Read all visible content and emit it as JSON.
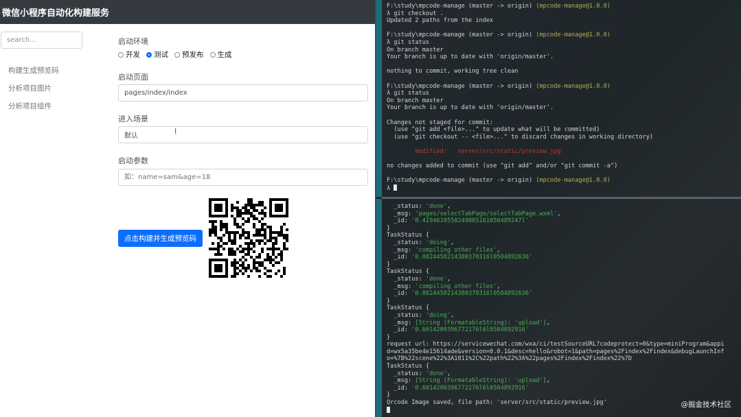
{
  "app": {
    "title": "微信小程序自动化构建服务",
    "search_placeholder": "search...",
    "sidebar": [
      {
        "label": "构建生成预览码"
      },
      {
        "label": "分析项目图片"
      },
      {
        "label": "分析项目组件"
      }
    ],
    "form": {
      "env_label": "启动环境",
      "env_options": [
        {
          "label": "开发",
          "checked": false
        },
        {
          "label": "测试",
          "checked": true
        },
        {
          "label": "预发布",
          "checked": false
        },
        {
          "label": "生成",
          "checked": false
        }
      ],
      "page_label": "启动页面",
      "page_value": "pages/index/index",
      "scene_label": "进入场景",
      "scene_value": "默认",
      "params_label": "启动参数",
      "params_placeholder": "如：name=sam&age=18",
      "build_button": "点击构建并生成预览码"
    },
    "accent_color": "#0d6efd"
  },
  "terminal_top": [
    [
      {
        "t": "F:\\study\\mpcode-manage ",
        "c": "t-path"
      },
      {
        "t": "(master -> origin) ",
        "c": "t-branch"
      },
      {
        "t": "(mpcode-manage@1.0.0)",
        "c": "t-pkg"
      }
    ],
    [
      {
        "t": "λ git checkout .",
        "c": "t-lambda"
      }
    ],
    [
      {
        "t": "Updated 2 paths from the index"
      }
    ],
    [
      {
        "t": ""
      }
    ],
    [
      {
        "t": "F:\\study\\mpcode-manage ",
        "c": "t-path"
      },
      {
        "t": "(master -> origin) ",
        "c": "t-branch"
      },
      {
        "t": "(mpcode-manage@1.0.0)",
        "c": "t-pkg"
      }
    ],
    [
      {
        "t": "λ git status",
        "c": "t-lambda"
      }
    ],
    [
      {
        "t": "On branch master"
      }
    ],
    [
      {
        "t": "Your branch is up to date with 'origin/master'."
      }
    ],
    [
      {
        "t": ""
      }
    ],
    [
      {
        "t": "nothing to commit, working tree clean"
      }
    ],
    [
      {
        "t": ""
      }
    ],
    [
      {
        "t": "F:\\study\\mpcode-manage ",
        "c": "t-path"
      },
      {
        "t": "(master -> origin) ",
        "c": "t-branch"
      },
      {
        "t": "(mpcode-manage@1.0.0)",
        "c": "t-pkg"
      }
    ],
    [
      {
        "t": "λ git status",
        "c": "t-lambda"
      }
    ],
    [
      {
        "t": "On branch master"
      }
    ],
    [
      {
        "t": "Your branch is up to date with 'origin/master'."
      }
    ],
    [
      {
        "t": ""
      }
    ],
    [
      {
        "t": "Changes not staged for commit:"
      }
    ],
    [
      {
        "t": "  (use \"git add <file>...\" to update what will be committed)"
      }
    ],
    [
      {
        "t": "  (use \"git checkout -- <file>...\" to discard changes in working directory)"
      }
    ],
    [
      {
        "t": ""
      }
    ],
    [
      {
        "t": "        modified:   server/src/static/preview.jpg",
        "c": "t-red"
      }
    ],
    [
      {
        "t": ""
      }
    ],
    [
      {
        "t": "no changes added to commit (use \"git add\" and/or \"git commit -a\")"
      }
    ],
    [
      {
        "t": ""
      }
    ],
    [
      {
        "t": "F:\\study\\mpcode-manage ",
        "c": "t-path"
      },
      {
        "t": "(master -> origin) ",
        "c": "t-branch"
      },
      {
        "t": "(mpcode-manage@1.0.0)",
        "c": "t-pkg"
      }
    ],
    [
      {
        "t": "λ ",
        "c": "t-lambda"
      },
      {
        "cursor": true
      }
    ]
  ],
  "terminal_bottom": [
    [
      {
        "t": "  _status: "
      },
      {
        "t": "'done'",
        "c": "t-str"
      },
      {
        "t": ","
      }
    ],
    [
      {
        "t": "  _msg: "
      },
      {
        "t": "'pages/selectTabPage/selectTabPage.wxml'",
        "c": "t-str"
      },
      {
        "t": ","
      }
    ],
    [
      {
        "t": "  _id: "
      },
      {
        "t": "'0.4194610558249885161050489247l'",
        "c": "t-str"
      }
    ],
    [
      {
        "t": "}"
      }
    ],
    [
      {
        "t": "TaskStatus {"
      }
    ],
    [
      {
        "t": "  _status: "
      },
      {
        "t": "'doing'",
        "c": "t-str"
      },
      {
        "t": ","
      }
    ],
    [
      {
        "t": "  _msg: "
      },
      {
        "t": "'compiling other files'",
        "c": "t-str"
      },
      {
        "t": ","
      }
    ],
    [
      {
        "t": "  _id: "
      },
      {
        "t": "'0.0824458214380370316l0504892636'",
        "c": "t-str"
      }
    ],
    [
      {
        "t": "}"
      }
    ],
    [
      {
        "t": "TaskStatus {"
      }
    ],
    [
      {
        "t": "  _status: "
      },
      {
        "t": "'done'",
        "c": "t-str"
      },
      {
        "t": ","
      }
    ],
    [
      {
        "t": "  _msg: "
      },
      {
        "t": "'compiling other files'",
        "c": "t-str"
      },
      {
        "t": ","
      }
    ],
    [
      {
        "t": "  _id: "
      },
      {
        "t": "'0.0824458214380370316l0504892636'",
        "c": "t-str"
      }
    ],
    [
      {
        "t": "}"
      }
    ],
    [
      {
        "t": "TaskStatus {"
      }
    ],
    [
      {
        "t": "  _status: "
      },
      {
        "t": "'doing'",
        "c": "t-str"
      },
      {
        "t": ","
      }
    ],
    [
      {
        "t": "  _msg: "
      },
      {
        "t": "[String (FormatableString): 'upload']",
        "c": "t-str"
      },
      {
        "t": ","
      }
    ],
    [
      {
        "t": "  _id: "
      },
      {
        "t": "'0.6014200396772176l6l0504892916'",
        "c": "t-str"
      }
    ],
    [
      {
        "t": "}"
      }
    ],
    [
      {
        "t": "request url: https://servicewechat.com/wxa/ci/testSourceURL?codeprotect=0&type=miniProgram&appi"
      }
    ],
    [
      {
        "t": "d=wx5a35be4e15614ade&version=0.0.1&desc=hello&robot=1&path=pages%2Findex%2Findex&debugLaunchInf"
      }
    ],
    [
      {
        "t": "o=%7B%22scene%22%3A1011%2C%22path%22%3A%22pages%2Findex%2Findex%22%7D"
      }
    ],
    [
      {
        "t": "TaskStatus {"
      }
    ],
    [
      {
        "t": "  _status: "
      },
      {
        "t": "'done'",
        "c": "t-str"
      },
      {
        "t": ","
      }
    ],
    [
      {
        "t": "  _msg: "
      },
      {
        "t": "[String (FormatableString): 'upload']",
        "c": "t-str"
      },
      {
        "t": ","
      }
    ],
    [
      {
        "t": "  _id: "
      },
      {
        "t": "'0.6014200396772176l6l0504892916'",
        "c": "t-str"
      }
    ],
    [
      {
        "t": "}"
      }
    ],
    [
      {
        "t": "Qrcode Image saved, file path: 'server/src/static/preview.jpg'"
      }
    ],
    [
      {
        "cursor": true
      }
    ]
  ],
  "watermark": "@掘金技术社区"
}
